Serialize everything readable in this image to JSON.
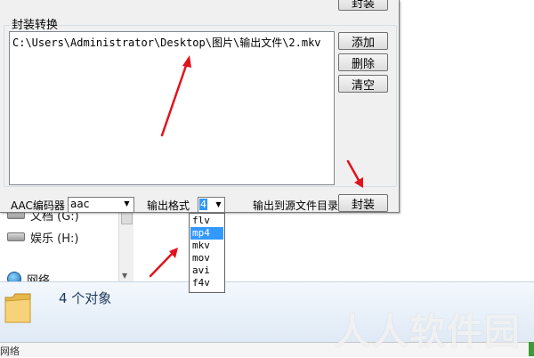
{
  "explorer": {
    "drives": [
      {
        "label": "文档 (G:)",
        "icon": "drive-icon"
      },
      {
        "label": "娱乐 (H:)",
        "icon": "drive-icon"
      }
    ],
    "network_label": "网络",
    "details": {
      "object_count": "4 个对象",
      "icon": "folder-icon"
    },
    "status_text": "网络"
  },
  "watermark": "人人软件园",
  "dialog": {
    "top_button": "封装",
    "group_title": "封装转换",
    "file_list": [
      "C:\\Users\\Administrator\\Desktop\\图片\\输出文件\\2.mkv"
    ],
    "buttons": {
      "add": "添加",
      "delete": "删除",
      "clear": "清空",
      "pack": "封装"
    },
    "encoder": {
      "label": "AAC编码器",
      "value": "aac"
    },
    "format": {
      "label": "输出格式",
      "value": "4",
      "options": [
        "flv",
        "mp4",
        "mkv",
        "mov",
        "avi",
        "f4v"
      ],
      "highlighted": "mp4"
    },
    "dest_label": "输出到源文件目录"
  },
  "colors": {
    "annotation_arrow": "#e0141e",
    "highlight": "#3399ff"
  }
}
